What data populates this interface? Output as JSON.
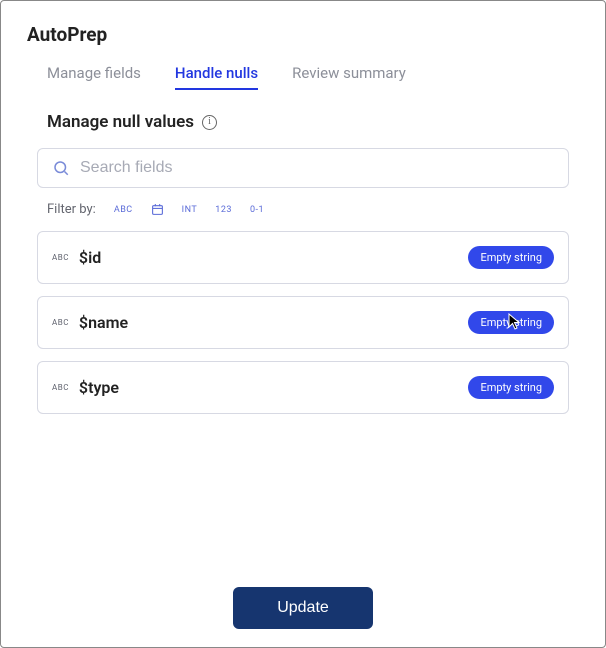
{
  "app": {
    "title": "AutoPrep"
  },
  "tabs": {
    "items": [
      {
        "label": "Manage fields",
        "active": false
      },
      {
        "label": "Handle nulls",
        "active": true
      },
      {
        "label": "Review summary",
        "active": false
      }
    ]
  },
  "section": {
    "title": "Manage null values"
  },
  "search": {
    "placeholder": "Search fields",
    "value": ""
  },
  "filter": {
    "label": "Filter by:",
    "chips": [
      "ABC",
      "date",
      "INT",
      "123",
      "0-1"
    ]
  },
  "fields": [
    {
      "type_badge": "ABC",
      "name": "$id",
      "null_handling": "Empty string"
    },
    {
      "type_badge": "ABC",
      "name": "$name",
      "null_handling": "Empty string",
      "cursor": true
    },
    {
      "type_badge": "ABC",
      "name": "$type",
      "null_handling": "Empty string"
    }
  ],
  "footer": {
    "update_label": "Update"
  }
}
